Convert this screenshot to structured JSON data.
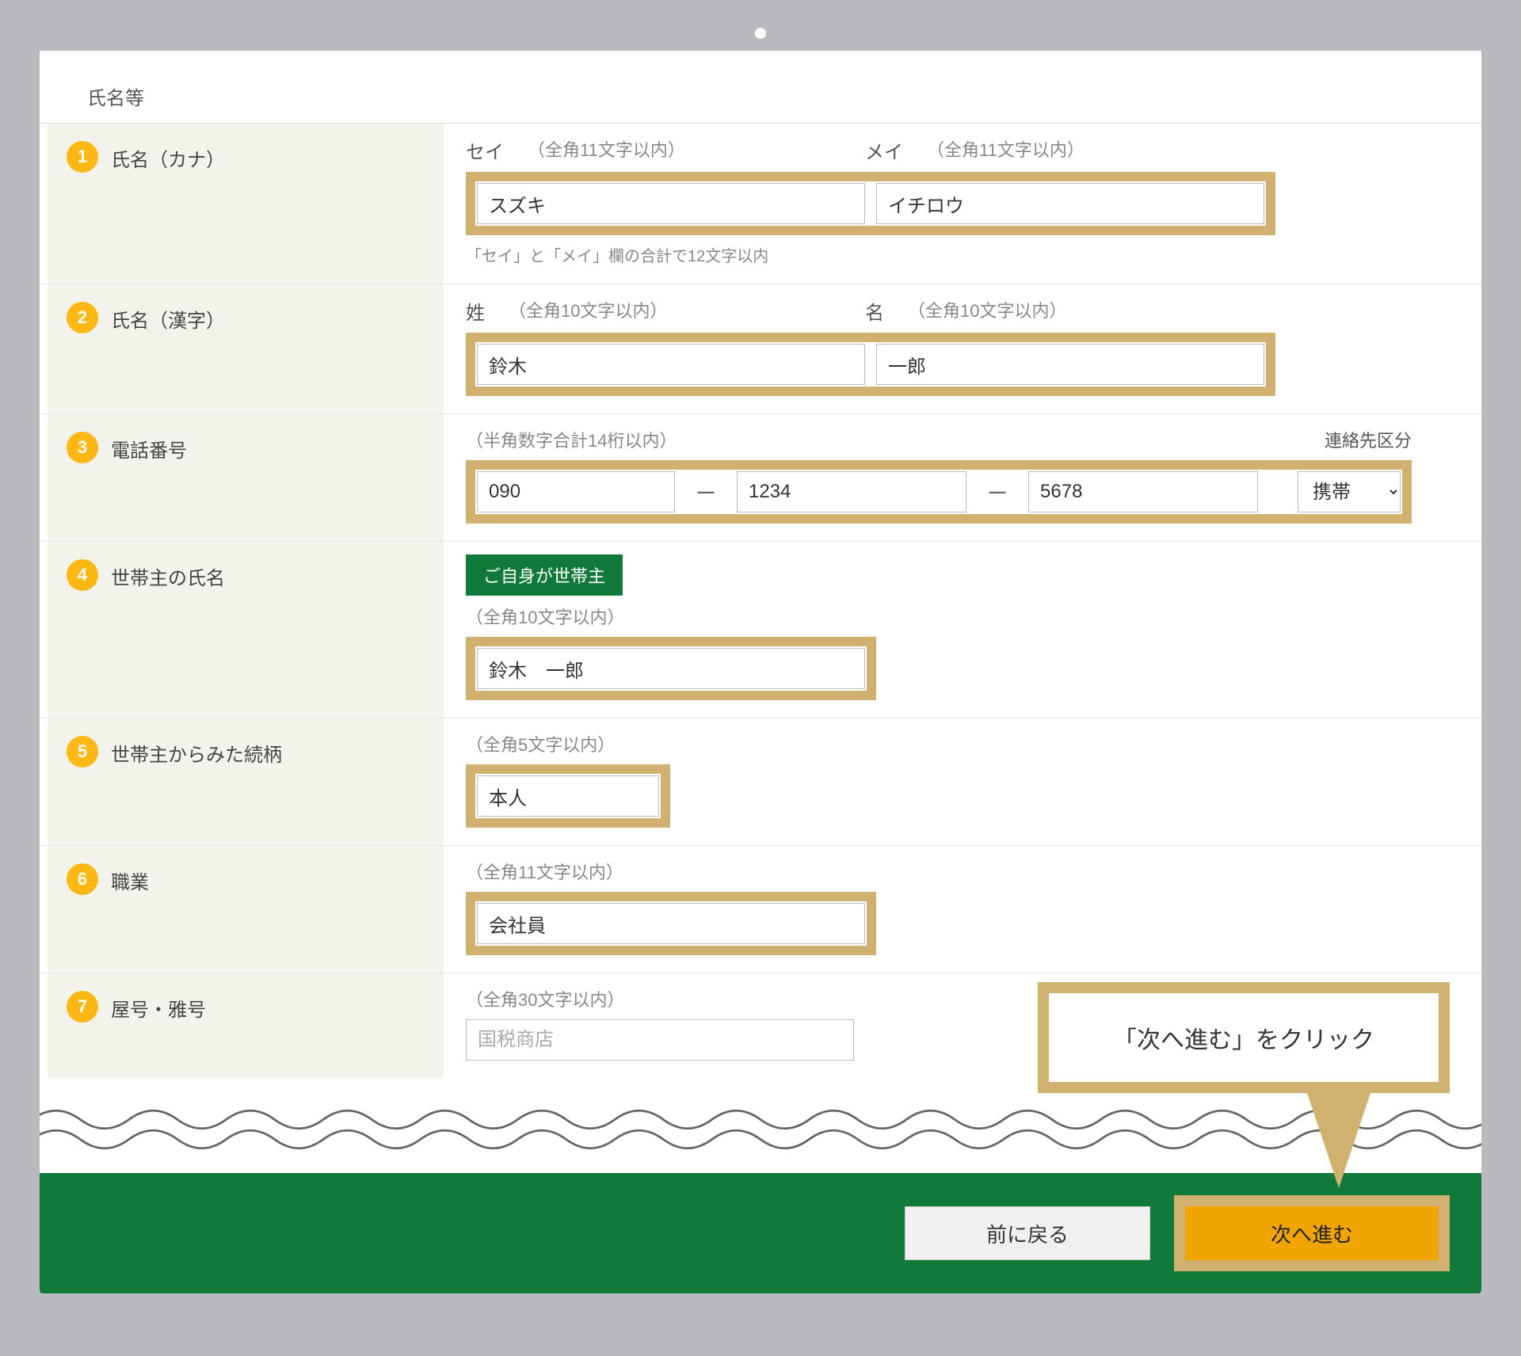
{
  "section_title": "氏名等",
  "rows": {
    "r1": {
      "badge": "1",
      "label": "氏名（カナ）",
      "sei_label": "セイ",
      "sei_paren": "（全角11文字以内）",
      "mei_label": "メイ",
      "mei_paren": "（全角11文字以内）",
      "sei_value": "スズキ",
      "mei_value": "イチロウ",
      "note": "「セイ」と「メイ」欄の合計で12文字以内"
    },
    "r2": {
      "badge": "2",
      "label": "氏名（漢字）",
      "sei_label": "姓",
      "sei_paren": "（全角10文字以内）",
      "mei_label": "名",
      "mei_paren": "（全角10文字以内）",
      "sei_value": "鈴木",
      "mei_value": "一郎"
    },
    "r3": {
      "badge": "3",
      "label": "電話番号",
      "paren": "（半角数字合計14桁以内）",
      "cls_label": "連絡先区分",
      "p1": "090",
      "p2": "1234",
      "p3": "5678",
      "select": "携帯",
      "dash": "ー"
    },
    "r4": {
      "badge": "4",
      "label": "世帯主の氏名",
      "green_btn": "ご自身が世帯主",
      "paren": "（全角10文字以内）",
      "value": "鈴木　一郎"
    },
    "r5": {
      "badge": "5",
      "label": "世帯主からみた続柄",
      "paren": "（全角5文字以内）",
      "value": "本人"
    },
    "r6": {
      "badge": "6",
      "label": "職業",
      "paren": "（全角11文字以内）",
      "value": "会社員"
    },
    "r7": {
      "badge": "7",
      "label": "屋号・雅号",
      "paren": "（全角30文字以内）",
      "placeholder": "国税商店"
    }
  },
  "callout": "「次へ進む」をクリック",
  "footer": {
    "back": "前に戻る",
    "next": "次へ進む"
  }
}
